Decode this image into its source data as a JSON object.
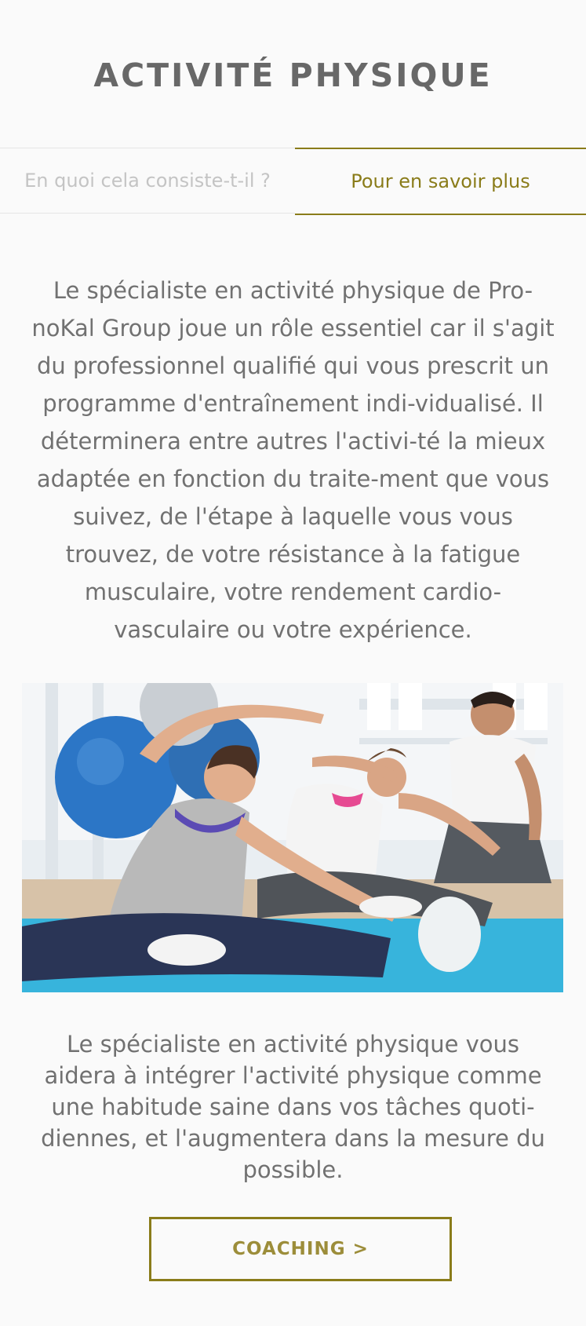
{
  "page": {
    "title": "ACTIVITÉ PHYSIQUE"
  },
  "tabs": [
    {
      "label": "En quoi cela consiste-t-il ?",
      "active": false
    },
    {
      "label": "Pour en savoir plus",
      "active": true
    }
  ],
  "content": {
    "intro": "Le spécialiste en activité physique de Pro-noKal Group joue un rôle essentiel car il s'agit du professionnel qualifié qui vous prescrit un programme d'entraînement indi-vidualisé. Il déterminera entre autres l'activi-té la mieux adaptée en fonction du traite-ment que vous suivez, de l'étape à laquelle vous vous trouvez, de votre résistance à la fatigue musculaire, votre rendement cardio-vasculaire ou votre expérience.",
    "photo_icon": "stretching-group-photo",
    "outro": "Le spécialiste en activité physique vous aidera à intégrer l'activité physique comme une habitude saine dans vos tâches quoti-diennes, et l'augmentera dans la mesure du possible."
  },
  "cta": {
    "label": "COACHING >"
  },
  "colors": {
    "accent": "#8a7c1a",
    "title": "#686868",
    "body_text": "#717171",
    "inactive_tab": "#c4c4c4",
    "background": "#fafafa"
  }
}
